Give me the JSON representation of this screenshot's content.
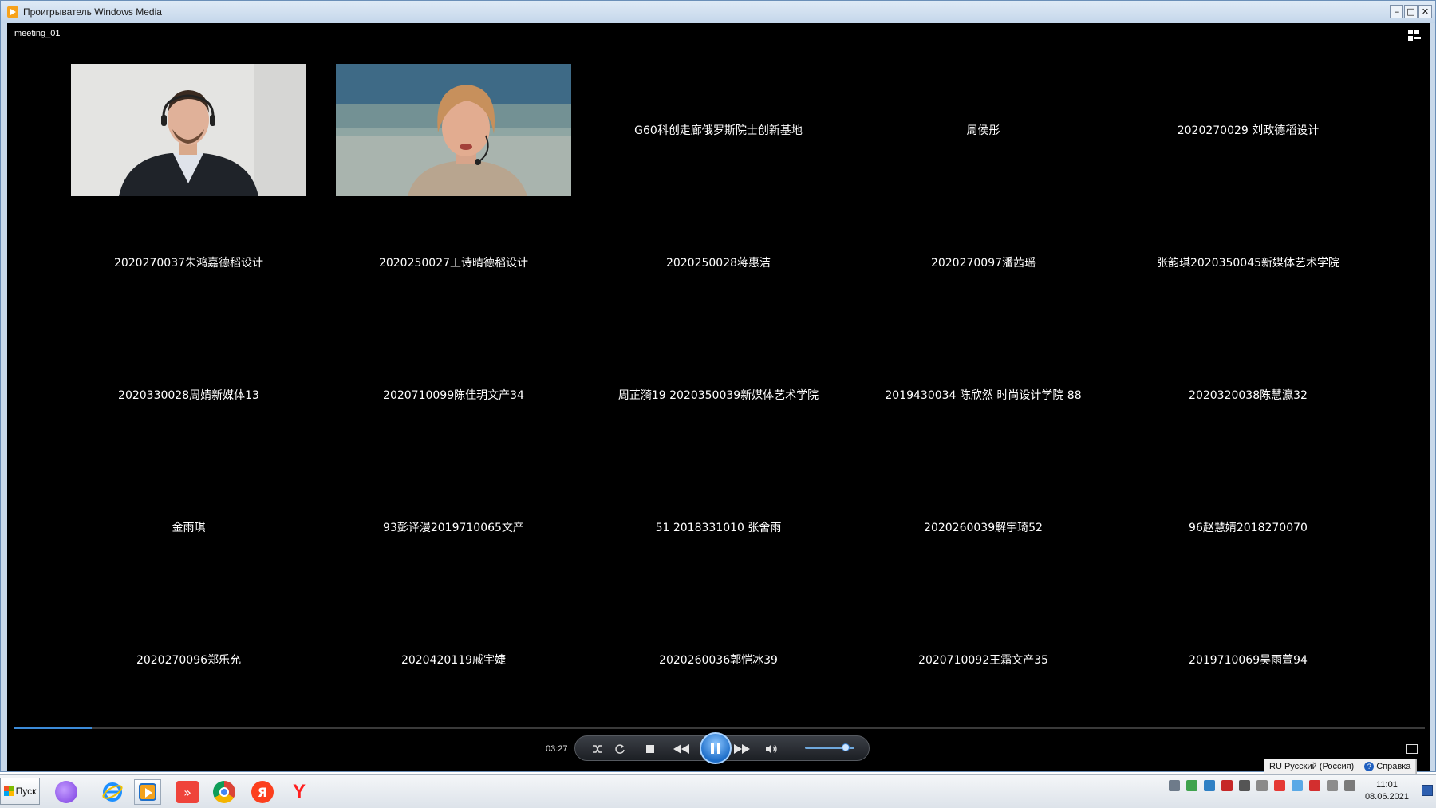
{
  "window": {
    "title": "Проигрыватель Windows Media",
    "minimize": "–",
    "maximize": "□",
    "close": "✕"
  },
  "video": {
    "file_name": "meeting_01",
    "participants": [
      {
        "name": "",
        "camera": true,
        "person": "man"
      },
      {
        "name": "",
        "camera": true,
        "person": "woman"
      },
      {
        "name": "G60科创走廊俄罗斯院士创新基地"
      },
      {
        "name": "周侯彤"
      },
      {
        "name": "2020270029 刘政德稻设计"
      },
      {
        "name": "2020270037朱鸿嘉德稻设计"
      },
      {
        "name": "2020250027王诗晴德稻设计"
      },
      {
        "name": "2020250028蒋惠洁"
      },
      {
        "name": "2020270097潘茜瑶"
      },
      {
        "name": "张韵琪2020350045新媒体艺术学院"
      },
      {
        "name": "2020330028周婧新媒体13"
      },
      {
        "name": "2020710099陈佳玥文产34"
      },
      {
        "name": "周芷漪19  2020350039新媒体艺术学院"
      },
      {
        "name": "2019430034 陈欣然 时尚设计学院 88"
      },
      {
        "name": "2020320038陈慧瀛32"
      },
      {
        "name": "金雨琪"
      },
      {
        "name": "93彭译漫2019710065文产"
      },
      {
        "name": "51 2018331010 张舍雨"
      },
      {
        "name": "2020260039解宇琦52"
      },
      {
        "name": "96赵慧婧2018270070"
      },
      {
        "name": "2020270096郑乐允"
      },
      {
        "name": "2020420119戚宇婕"
      },
      {
        "name": "2020260036郭恺冰39"
      },
      {
        "name": "2020710092王霜文产35"
      },
      {
        "name": "2019710069吴雨萱94"
      }
    ]
  },
  "player": {
    "time": "03:27",
    "progress": 0.055,
    "volume": 0.82,
    "buttons": [
      "shuffle-icon",
      "repeat-icon",
      "stop-icon",
      "previous-icon",
      "pause-icon",
      "next-icon",
      "volume-icon"
    ]
  },
  "langbar": {
    "language": "RU Русский (Россия)",
    "help": "Справка"
  },
  "taskbar": {
    "start_label": "Пуск",
    "clock_time": "11:01",
    "clock_date": "08.06.2021"
  },
  "colors": {
    "accent": "#3c8bd9",
    "video_bg": "#000000"
  }
}
